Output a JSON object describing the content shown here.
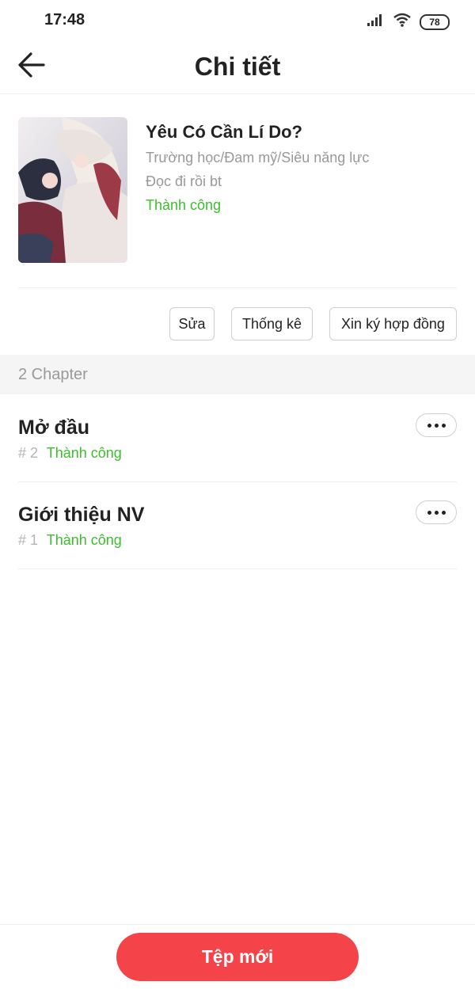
{
  "status_bar": {
    "time": "17:48",
    "battery": "78"
  },
  "header": {
    "title": "Chi tiết",
    "back_icon": "arrow-left-icon"
  },
  "book": {
    "title": "Yêu Có Cần Lí Do?",
    "genre": "Trường học/Đam mỹ/Siêu năng lực",
    "description": "Đọc đi rồi bt",
    "status": "Thành công"
  },
  "actions": {
    "edit_label": "Sửa",
    "stats_label": "Thống kê",
    "contract_label": "Xin ký hợp đồng"
  },
  "chapter_section": {
    "count_label": "2 Chapter"
  },
  "chapters": [
    {
      "title": "Mở đầu",
      "number": "# 2",
      "status": "Thành công"
    },
    {
      "title": "Giới thiệu NV",
      "number": "# 1",
      "status": "Thành công"
    }
  ],
  "bottom": {
    "new_label": "Tệp mới"
  },
  "colors": {
    "accent": "#f5434a",
    "success": "#3cbf2c",
    "muted": "#999999"
  }
}
